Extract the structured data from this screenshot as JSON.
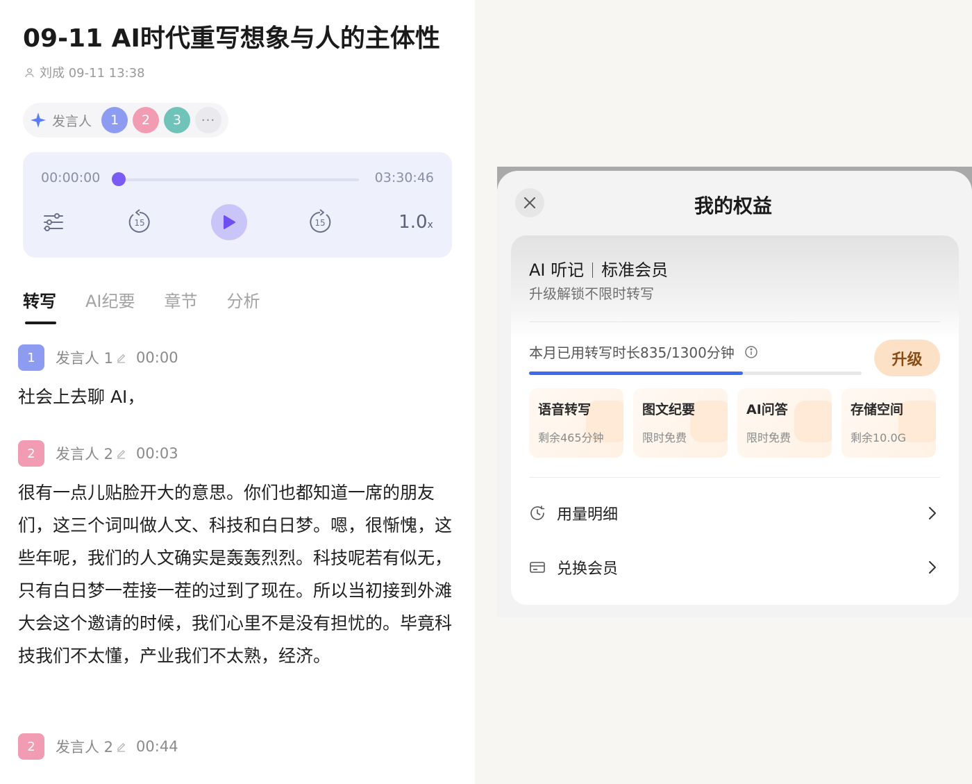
{
  "note": {
    "title": "09-11 AI时代重写想象与人的主体性",
    "meta": "刘成 09-11 13:38"
  },
  "speakers_bar": {
    "label": "发言人",
    "avatars": [
      "1",
      "2",
      "3"
    ],
    "more": "···"
  },
  "player": {
    "current_time": "00:00:00",
    "total_time": "03:30:46",
    "progress_fraction": 0.0,
    "rewind_label": "15",
    "forward_label": "15",
    "speed_value": "1.0",
    "speed_unit": "x"
  },
  "tabs": [
    {
      "label": "转写",
      "active": true
    },
    {
      "label": "AI纪要",
      "active": false
    },
    {
      "label": "章节",
      "active": false
    },
    {
      "label": "分析",
      "active": false
    }
  ],
  "transcript": [
    {
      "badge": "1",
      "speaker": "发言人 1",
      "time": "00:00",
      "text": "社会上去聊 AI，"
    },
    {
      "badge": "2",
      "speaker": "发言人 2",
      "time": "00:03",
      "text": "很有一点儿贴脸开大的意思。你们也都知道一席的朋友们，这三个词叫做人文、科技和白日梦。嗯，很惭愧，这些年呢，我们的人文确实是轰轰烈烈。科技呢若有似无，只有白日梦一茬接一茬的过到了现在。所以当初接到外滩大会这个邀请的时候，我们心里不是没有担忧的。毕竟科技我们不太懂，产业我们不太熟，经济。"
    },
    {
      "badge": "2",
      "speaker": "发言人 2",
      "time": "00:44",
      "text": ""
    }
  ],
  "benefits_sheet": {
    "title": "我的权益",
    "plan_product": "AI 听记",
    "plan_tier": "标准会员",
    "plan_subtitle": "升级解锁不限时转写",
    "usage_text": "本月已用转写时长835/1300分钟",
    "usage_fraction": 0.642,
    "upgrade_label": "升级",
    "features": [
      {
        "name": "语音转写",
        "sub": "剩余465分钟"
      },
      {
        "name": "图文纪要",
        "sub": "限时免费"
      },
      {
        "name": "AI问答",
        "sub": "限时免费"
      },
      {
        "name": "存储空间",
        "sub": "剩余10.0G"
      }
    ],
    "rows": [
      {
        "label": "用量明细",
        "icon": "clock-history-icon"
      },
      {
        "label": "兑换会员",
        "icon": "card-icon"
      }
    ]
  },
  "colors": {
    "accent_purple": "#7a5cf5",
    "progress_blue": "#3b6cf0",
    "upgrade_bg": "#fde1c6",
    "speaker1": "#8d9cf0",
    "speaker2": "#f29cb3",
    "speaker3": "#6fc3b8"
  }
}
